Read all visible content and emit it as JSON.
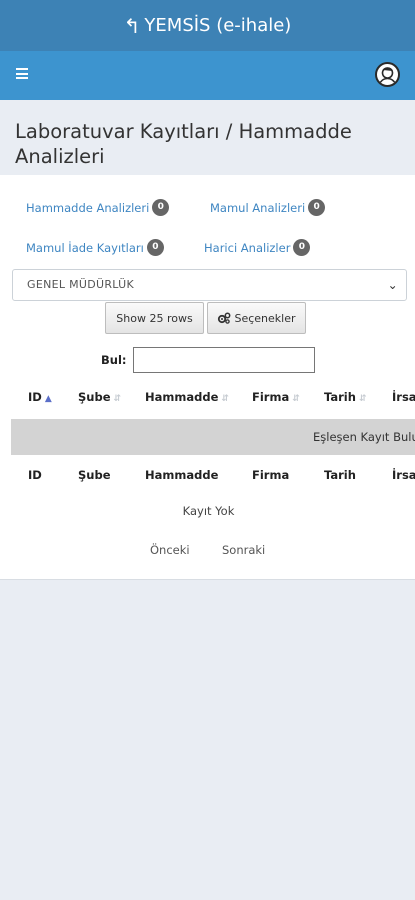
{
  "app": {
    "back_glyph": "↰",
    "title": "YEMSİS (e-ihale)"
  },
  "colors": {
    "topbar": "#3d82b5",
    "navbar": "#3d94cf",
    "link": "#3f86c2",
    "badge": "#666666"
  },
  "icons": {
    "menu": "hamburger-icon",
    "avatar": "user-avatar-icon",
    "back": "back-arrow-icon",
    "options": "gears-icon",
    "select": "chevron-down-icon"
  },
  "page": {
    "title": "Laboratuvar Kayıtları / Hammadde Analizleri"
  },
  "tabs": [
    {
      "label": "Hammadde Analizleri",
      "count": "0"
    },
    {
      "label": "Mamul Analizleri",
      "count": "0"
    },
    {
      "label": "Mamul İade Kayıtları",
      "count": "0"
    },
    {
      "label": "Harici Analizler",
      "count": "0"
    }
  ],
  "filter": {
    "selected": "GENEL MÜDÜRLÜK"
  },
  "buttons": {
    "show_rows": "Show 25 rows",
    "options": "Seçenekler"
  },
  "search": {
    "label": "Bul:",
    "value": ""
  },
  "table": {
    "columns": [
      "ID",
      "Şube",
      "Hammadde",
      "Firma",
      "Tarih",
      "İrsa"
    ],
    "empty_message": "Eşleşen Kayıt Bulunamadı",
    "footer_columns": [
      "ID",
      "Şube",
      "Hammadde",
      "Firma",
      "Tarih",
      "İrsa"
    ],
    "no_records": "Kayıt Yok"
  },
  "pagination": {
    "prev": "Önceki",
    "next": "Sonraki"
  }
}
